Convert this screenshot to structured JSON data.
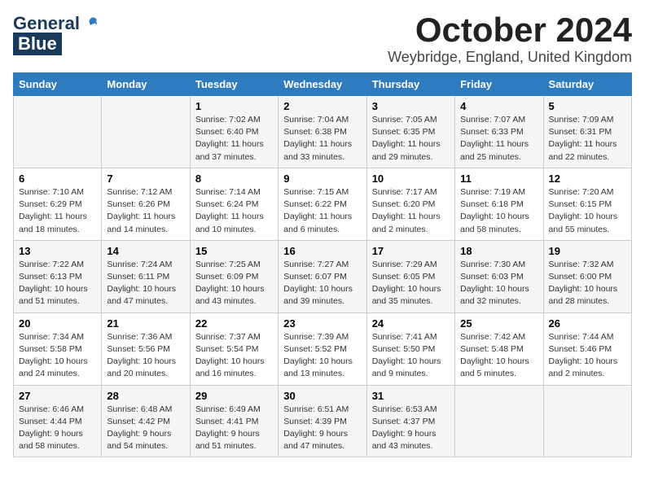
{
  "header": {
    "logo_general": "General",
    "logo_blue": "Blue",
    "month_title": "October 2024",
    "location": "Weybridge, England, United Kingdom"
  },
  "days_of_week": [
    "Sunday",
    "Monday",
    "Tuesday",
    "Wednesday",
    "Thursday",
    "Friday",
    "Saturday"
  ],
  "weeks": [
    [
      {
        "day": "",
        "info": ""
      },
      {
        "day": "",
        "info": ""
      },
      {
        "day": "1",
        "info": "Sunrise: 7:02 AM\nSunset: 6:40 PM\nDaylight: 11 hours\nand 37 minutes."
      },
      {
        "day": "2",
        "info": "Sunrise: 7:04 AM\nSunset: 6:38 PM\nDaylight: 11 hours\nand 33 minutes."
      },
      {
        "day": "3",
        "info": "Sunrise: 7:05 AM\nSunset: 6:35 PM\nDaylight: 11 hours\nand 29 minutes."
      },
      {
        "day": "4",
        "info": "Sunrise: 7:07 AM\nSunset: 6:33 PM\nDaylight: 11 hours\nand 25 minutes."
      },
      {
        "day": "5",
        "info": "Sunrise: 7:09 AM\nSunset: 6:31 PM\nDaylight: 11 hours\nand 22 minutes."
      }
    ],
    [
      {
        "day": "6",
        "info": "Sunrise: 7:10 AM\nSunset: 6:29 PM\nDaylight: 11 hours\nand 18 minutes."
      },
      {
        "day": "7",
        "info": "Sunrise: 7:12 AM\nSunset: 6:26 PM\nDaylight: 11 hours\nand 14 minutes."
      },
      {
        "day": "8",
        "info": "Sunrise: 7:14 AM\nSunset: 6:24 PM\nDaylight: 11 hours\nand 10 minutes."
      },
      {
        "day": "9",
        "info": "Sunrise: 7:15 AM\nSunset: 6:22 PM\nDaylight: 11 hours\nand 6 minutes."
      },
      {
        "day": "10",
        "info": "Sunrise: 7:17 AM\nSunset: 6:20 PM\nDaylight: 11 hours\nand 2 minutes."
      },
      {
        "day": "11",
        "info": "Sunrise: 7:19 AM\nSunset: 6:18 PM\nDaylight: 10 hours\nand 58 minutes."
      },
      {
        "day": "12",
        "info": "Sunrise: 7:20 AM\nSunset: 6:15 PM\nDaylight: 10 hours\nand 55 minutes."
      }
    ],
    [
      {
        "day": "13",
        "info": "Sunrise: 7:22 AM\nSunset: 6:13 PM\nDaylight: 10 hours\nand 51 minutes."
      },
      {
        "day": "14",
        "info": "Sunrise: 7:24 AM\nSunset: 6:11 PM\nDaylight: 10 hours\nand 47 minutes."
      },
      {
        "day": "15",
        "info": "Sunrise: 7:25 AM\nSunset: 6:09 PM\nDaylight: 10 hours\nand 43 minutes."
      },
      {
        "day": "16",
        "info": "Sunrise: 7:27 AM\nSunset: 6:07 PM\nDaylight: 10 hours\nand 39 minutes."
      },
      {
        "day": "17",
        "info": "Sunrise: 7:29 AM\nSunset: 6:05 PM\nDaylight: 10 hours\nand 35 minutes."
      },
      {
        "day": "18",
        "info": "Sunrise: 7:30 AM\nSunset: 6:03 PM\nDaylight: 10 hours\nand 32 minutes."
      },
      {
        "day": "19",
        "info": "Sunrise: 7:32 AM\nSunset: 6:00 PM\nDaylight: 10 hours\nand 28 minutes."
      }
    ],
    [
      {
        "day": "20",
        "info": "Sunrise: 7:34 AM\nSunset: 5:58 PM\nDaylight: 10 hours\nand 24 minutes."
      },
      {
        "day": "21",
        "info": "Sunrise: 7:36 AM\nSunset: 5:56 PM\nDaylight: 10 hours\nand 20 minutes."
      },
      {
        "day": "22",
        "info": "Sunrise: 7:37 AM\nSunset: 5:54 PM\nDaylight: 10 hours\nand 16 minutes."
      },
      {
        "day": "23",
        "info": "Sunrise: 7:39 AM\nSunset: 5:52 PM\nDaylight: 10 hours\nand 13 minutes."
      },
      {
        "day": "24",
        "info": "Sunrise: 7:41 AM\nSunset: 5:50 PM\nDaylight: 10 hours\nand 9 minutes."
      },
      {
        "day": "25",
        "info": "Sunrise: 7:42 AM\nSunset: 5:48 PM\nDaylight: 10 hours\nand 5 minutes."
      },
      {
        "day": "26",
        "info": "Sunrise: 7:44 AM\nSunset: 5:46 PM\nDaylight: 10 hours\nand 2 minutes."
      }
    ],
    [
      {
        "day": "27",
        "info": "Sunrise: 6:46 AM\nSunset: 4:44 PM\nDaylight: 9 hours\nand 58 minutes."
      },
      {
        "day": "28",
        "info": "Sunrise: 6:48 AM\nSunset: 4:42 PM\nDaylight: 9 hours\nand 54 minutes."
      },
      {
        "day": "29",
        "info": "Sunrise: 6:49 AM\nSunset: 4:41 PM\nDaylight: 9 hours\nand 51 minutes."
      },
      {
        "day": "30",
        "info": "Sunrise: 6:51 AM\nSunset: 4:39 PM\nDaylight: 9 hours\nand 47 minutes."
      },
      {
        "day": "31",
        "info": "Sunrise: 6:53 AM\nSunset: 4:37 PM\nDaylight: 9 hours\nand 43 minutes."
      },
      {
        "day": "",
        "info": ""
      },
      {
        "day": "",
        "info": ""
      }
    ]
  ]
}
